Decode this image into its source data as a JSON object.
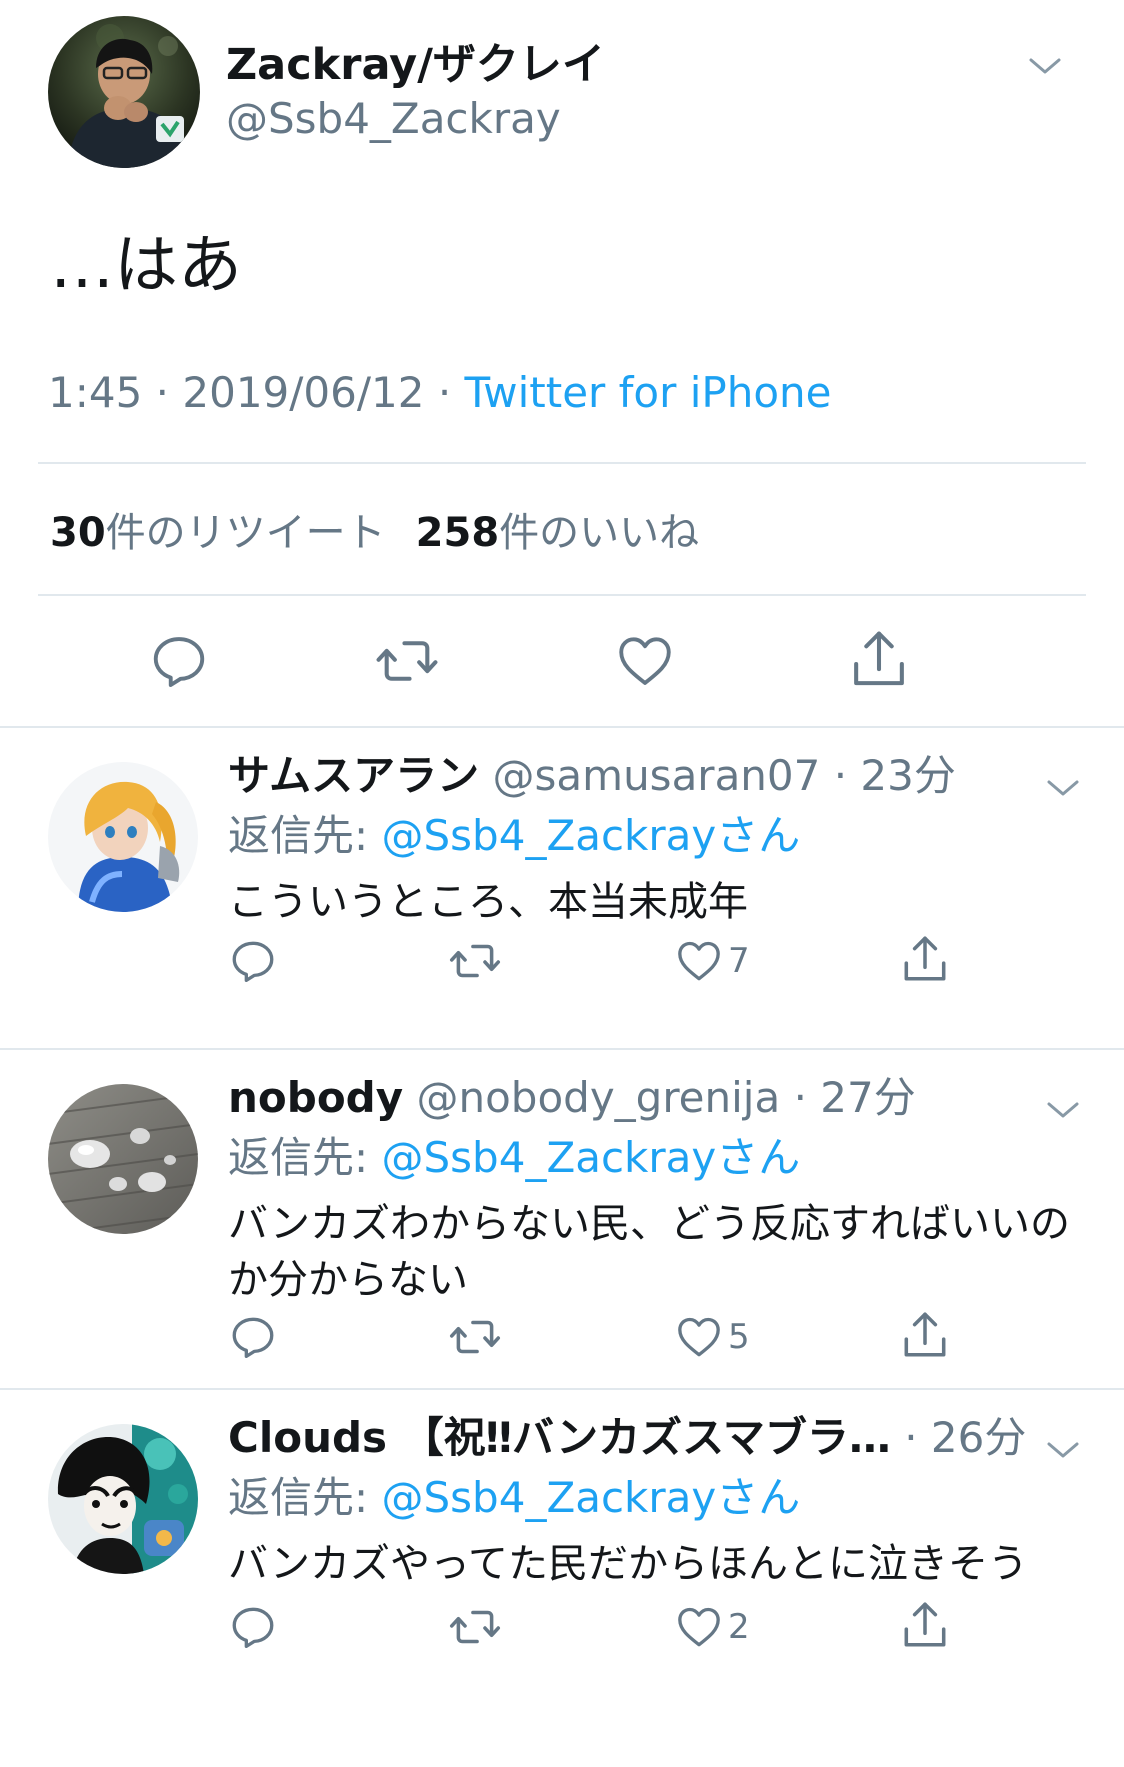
{
  "main_tweet": {
    "display_name": "Zackray/ザクレイ",
    "handle": "@Ssb4_Zackray",
    "text": "…はあ",
    "time": "1:45",
    "date": "2019/06/12",
    "source": "Twitter for iPhone",
    "sep": " · ",
    "retweet_count": "30",
    "retweet_label": "件のリツイート",
    "like_count": "258",
    "like_label": "件のいいね"
  },
  "icons": {
    "reply": "reply-icon",
    "retweet": "retweet-icon",
    "like": "heart-icon",
    "share": "share-icon",
    "menu": "chevron-down-icon"
  },
  "colors": {
    "link": "#1da1f2",
    "secondary_text": "#657786",
    "divider": "#e1e8ed"
  },
  "replies": [
    {
      "display_name": "サムスアラン",
      "handle": "@samusaran07",
      "time": "· 23分",
      "reply_prefix": "返信先: ",
      "reply_to": "@Ssb4_Zackrayさん",
      "text": "こういうところ、本当未成年",
      "like_count": "7"
    },
    {
      "display_name": "nobody",
      "handle": "@nobody_grenija",
      "time": "· 27分",
      "reply_prefix": "返信先: ",
      "reply_to": "@Ssb4_Zackrayさん",
      "text": "バンカズわからない民、どう反応すればいいのか分からない",
      "like_count": "5"
    },
    {
      "display_name": "Clouds 【祝‼バンカズスマブラ…",
      "handle": "",
      "time": "· 26分",
      "reply_prefix": "返信先: ",
      "reply_to": "@Ssb4_Zackrayさん",
      "text": "バンカズやってた民だからほんとに泣きそう",
      "like_count": "2"
    }
  ]
}
